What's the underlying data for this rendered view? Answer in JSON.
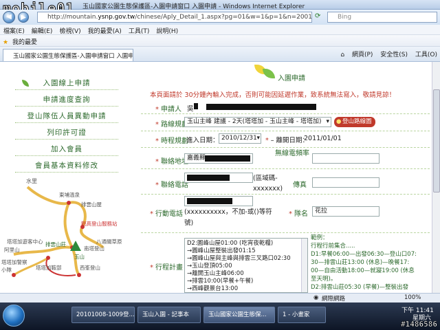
{
  "watermark": "mobile01",
  "window": {
    "title": "玉山國家公園生態保護區-入園申請窗口 入園申請 - Windows Internet Explorer"
  },
  "address": {
    "url_prefix": "http://mountain.",
    "url_domain": "ysnp.gov.tw",
    "url_path": "/chinese/Aply_Detail_1.aspx?pg=01&w=1&p=1&n=2001",
    "search_placeholder": "Bing"
  },
  "menu": [
    "檔案(E)",
    "編輯(E)",
    "檢視(V)",
    "我的最愛(A)",
    "工具(T)",
    "說明(H)"
  ],
  "favorites": {
    "label": "我的最愛"
  },
  "tab": {
    "title": "玉山國家公園生態保護區-入園申請窗口 入園申請"
  },
  "commands": [
    "網頁(P)",
    "安全性(S)",
    "工具(O)"
  ],
  "left_menu": [
    "入園線上申請",
    "申請進度查詢",
    "登山隊伍人員異動申請",
    "列印許可證",
    "加入會員",
    "會員基本資料修改"
  ],
  "map_labels": {
    "shuili": "水里",
    "dongpu": "東埔溫泉",
    "paiyun_hut": "排雲山屋",
    "dongpu_station": "觀高登山服務站",
    "tatajia_lodge": "塔塔加遊客中心",
    "alishan": "阿里山",
    "tatajia_police": "塔塔加警察小隊",
    "tatajia_saddle": "塔塔加鞍部",
    "paiyun_station": "排雲山莊",
    "yushan": "玉山",
    "babie": "八通關草原",
    "huxin": "南塔登山",
    "dongcao": "西峯登山"
  },
  "form": {
    "header_title": "入園申請",
    "notice": "本頁面請於 30分鐘內輸入完成，否則可能因延遲作業，致系統無法寫入，敬請見諒！",
    "applicant_label": "申請人",
    "applicant_value": "吳",
    "route_label": "路線規劃",
    "route_value": "玉山主峰 建議 - 2天(塔塔加 - 玉山主峰 - 塔塔加)",
    "route_button": "登山路線圖",
    "schedule_label": "時程規劃",
    "entry_label": "進入日期：",
    "entry_value": "2010/12/31",
    "exit_label": "離開日期：",
    "exit_value": "2011/01/01",
    "address_label": "聯絡地址",
    "address_value": "嘉義縣",
    "radio_label": "無線電頻率",
    "phone_label": "聯絡電話",
    "phone_hint": "(區域碼-xxxxxxx)",
    "fax_label": "傳真",
    "mobile_label": "行動電話",
    "mobile_hint": "(xxxxxxxxxx，不加-或()等符號)",
    "team_label": "隊名",
    "team_value": "花拉",
    "plan_label": "行程計畫",
    "plan_lines": [
      "D2:圓峰山屋01:00 (吃宵夜乾糧)",
      "→圓峰山屋整裝出發01:15",
      "→圓峰山屋與主峰與排雲三叉路口02:30",
      "→玉山登頂05:00",
      "→離開玉山主峰06:00",
      "→排雲10:00(早餐+午餐)",
      "→西峰觀景台13:00"
    ],
    "example_title": "範例：",
    "example_subtitle": "行程行前集合.....",
    "example_lines": [
      "D1:早餐06:00—出發06:30—登山口07:",
      "30—排雲山莊13:00 (休息)—晚餐17:",
      "00—自由活動18:00—就寢19:00 (休息",
      "至天明)。",
      "D2:排雲山莊05:30 (早餐)—整裝出發"
    ]
  },
  "statusbar": {
    "zone": "網際網路",
    "zoom": "100%"
  },
  "taskbar": {
    "items": [
      "20101008-1009登...",
      "玉山入園 - 記事本",
      "玉山國家公園生態保...",
      "1 - 小畫家"
    ],
    "time": "下午 11:41",
    "day": "星期六",
    "post_id": "#1486586"
  },
  "colors": {
    "accent_green": "#2d6a2d",
    "warning_red": "#c0392b",
    "route_button": "#c0392b"
  }
}
